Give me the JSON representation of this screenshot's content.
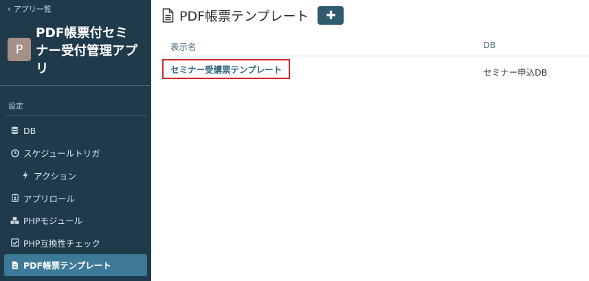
{
  "sidebar": {
    "back_label": "アプリ一覧",
    "app_avatar_letter": "P",
    "app_title": "PDF帳票付セミナー受付管理アプリ",
    "section_label": "設定",
    "items": [
      {
        "label": "DB",
        "icon": "database-icon"
      },
      {
        "label": "スケジュールトリガ",
        "icon": "clock-icon"
      },
      {
        "label": "アクション",
        "icon": "bolt-icon"
      },
      {
        "label": "アプリロール",
        "icon": "badge-icon"
      },
      {
        "label": "PHPモジュール",
        "icon": "cubes-icon"
      },
      {
        "label": "PHP互換性チェック",
        "icon": "check-square-icon"
      },
      {
        "label": "PDF帳票テンプレート",
        "icon": "document-icon"
      }
    ]
  },
  "main": {
    "title": "PDF帳票テンプレート",
    "add_button_label": "✚",
    "table": {
      "headers": {
        "name": "表示名",
        "db": "DB"
      },
      "rows": [
        {
          "name": "セミナー受講票テンプレート",
          "db": "セミナー申込DB"
        }
      ]
    }
  },
  "colors": {
    "sidebar_bg": "#1f3a4b",
    "active_item_bg": "#3d7a98",
    "button_bg": "#2f5a70",
    "highlight_border": "#d0262c"
  }
}
